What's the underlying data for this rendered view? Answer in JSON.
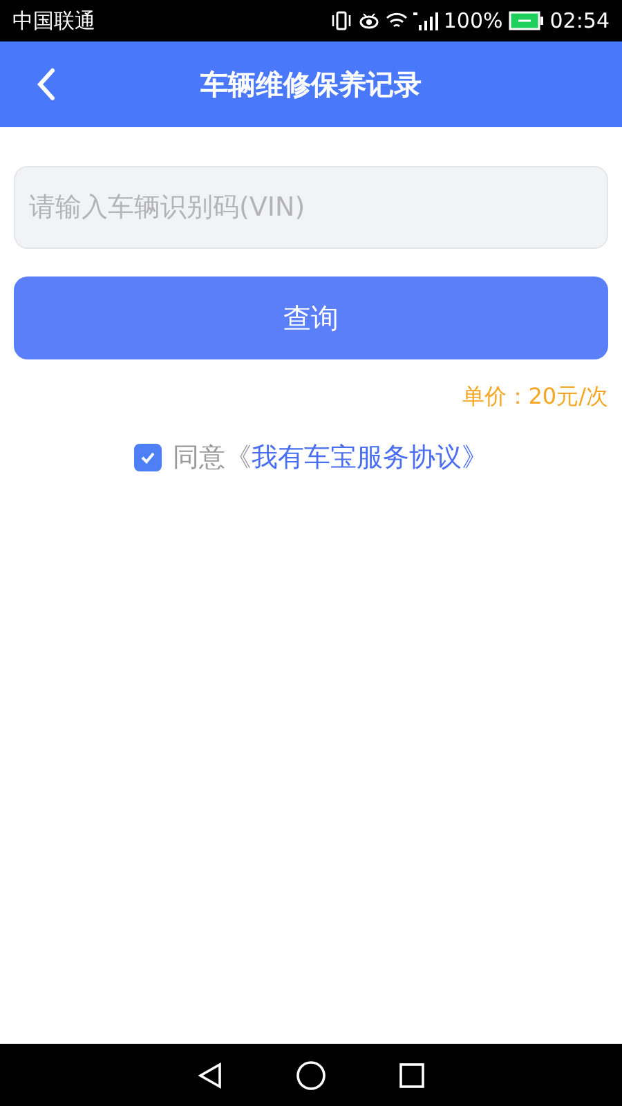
{
  "status_bar": {
    "carrier": "中国联通",
    "battery": "100%",
    "time": "02:54"
  },
  "header": {
    "title": "车辆维修保养记录"
  },
  "search": {
    "placeholder": "请输入车辆识别码(VIN)"
  },
  "query_button": "查询",
  "price": "单价：20元/次",
  "agreement": {
    "checked": true,
    "text": "同意《",
    "link": "我有车宝服务协议》"
  }
}
